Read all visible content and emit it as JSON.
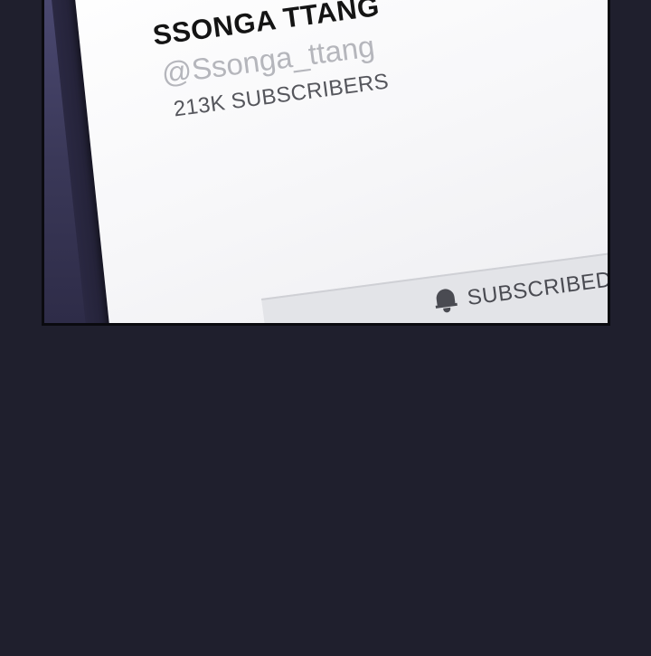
{
  "channel": {
    "name": "SSONGA TTANG",
    "handle": "@Ssonga_ttang",
    "subscribers": "213K SUBSCRIBERS"
  },
  "subscribe_button": {
    "label": "SUBSCRIBED",
    "icon": "bell-icon"
  },
  "colors": {
    "page_background": "#1f1f2d",
    "screen": "#f7f7f9",
    "button_background": "#e3e4e8",
    "name_text": "#141414",
    "handle_text": "#b5b6bc"
  }
}
